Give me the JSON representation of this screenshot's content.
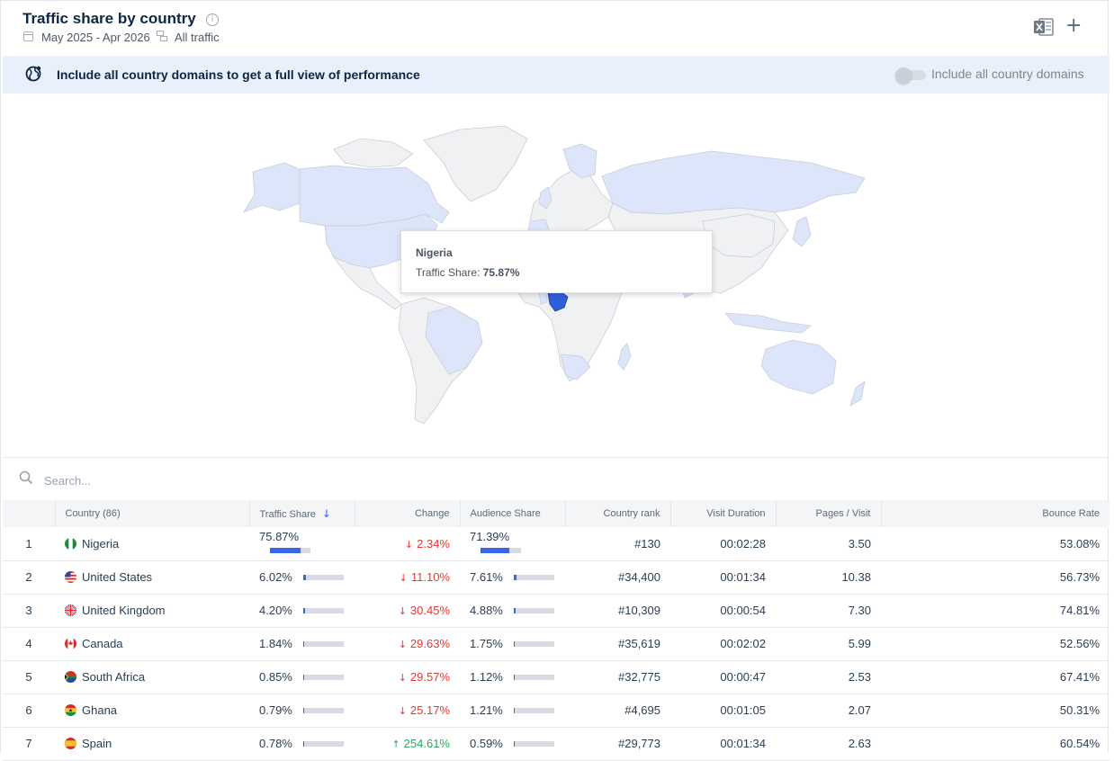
{
  "header": {
    "title": "Traffic share by country",
    "date_range": "May 2025 - Apr 2026",
    "traffic_type": "All traffic"
  },
  "banner": {
    "text": "Include all country domains to get a full view of performance",
    "toggle_label": "Include all country domains",
    "toggle_on": false
  },
  "tooltip": {
    "country": "Nigeria",
    "label": "Traffic Share:",
    "value": "75.87%"
  },
  "search": {
    "placeholder": "Search..."
  },
  "columns": {
    "country": "Country (86)",
    "traffic_share": "Traffic Share",
    "change": "Change",
    "audience_share": "Audience Share",
    "country_rank": "Country rank",
    "visit_duration": "Visit Duration",
    "pages_visit": "Pages / Visit",
    "bounce_rate": "Bounce Rate"
  },
  "rows": [
    {
      "n": "1",
      "country": "Nigeria",
      "flag": "ng",
      "share": "75.87%",
      "share_frac": 0.7587,
      "dir": "down",
      "change": "2.34%",
      "aud": "71.39%",
      "aud_frac": 0.7139,
      "rank": "#130",
      "dur": "00:02:28",
      "pages": "3.50",
      "bounce": "53.08%"
    },
    {
      "n": "2",
      "country": "United States",
      "flag": "us",
      "share": "6.02%",
      "share_frac": 0.0602,
      "dir": "down",
      "change": "11.10%",
      "aud": "7.61%",
      "aud_frac": 0.0761,
      "rank": "#34,400",
      "dur": "00:01:34",
      "pages": "10.38",
      "bounce": "56.73%"
    },
    {
      "n": "3",
      "country": "United Kingdom",
      "flag": "gb",
      "share": "4.20%",
      "share_frac": 0.042,
      "dir": "down",
      "change": "30.45%",
      "aud": "4.88%",
      "aud_frac": 0.0488,
      "rank": "#10,309",
      "dur": "00:00:54",
      "pages": "7.30",
      "bounce": "74.81%"
    },
    {
      "n": "4",
      "country": "Canada",
      "flag": "ca",
      "share": "1.84%",
      "share_frac": 0.0184,
      "dir": "down",
      "change": "29.63%",
      "aud": "1.75%",
      "aud_frac": 0.0175,
      "rank": "#35,619",
      "dur": "00:02:02",
      "pages": "5.99",
      "bounce": "52.56%"
    },
    {
      "n": "5",
      "country": "South Africa",
      "flag": "za",
      "share": "0.85%",
      "share_frac": 0.0085,
      "dir": "down",
      "change": "29.57%",
      "aud": "1.12%",
      "aud_frac": 0.0112,
      "rank": "#32,775",
      "dur": "00:00:47",
      "pages": "2.53",
      "bounce": "67.41%"
    },
    {
      "n": "6",
      "country": "Ghana",
      "flag": "gh",
      "share": "0.79%",
      "share_frac": 0.0079,
      "dir": "down",
      "change": "25.17%",
      "aud": "1.21%",
      "aud_frac": 0.0121,
      "rank": "#4,695",
      "dur": "00:01:05",
      "pages": "2.07",
      "bounce": "50.31%"
    },
    {
      "n": "7",
      "country": "Spain",
      "flag": "es",
      "share": "0.78%",
      "share_frac": 0.0078,
      "dir": "up",
      "change": "254.61%",
      "aud": "0.59%",
      "aud_frac": 0.0059,
      "rank": "#29,773",
      "dur": "00:01:34",
      "pages": "2.63",
      "bounce": "60.54%"
    }
  ],
  "colors": {
    "accent": "#3a66e6",
    "down": "#e53935",
    "up": "#26a65b",
    "map_land": "#f0f1f3",
    "map_highlight": "#dde5fa",
    "map_selected": "#2f5fd8"
  }
}
